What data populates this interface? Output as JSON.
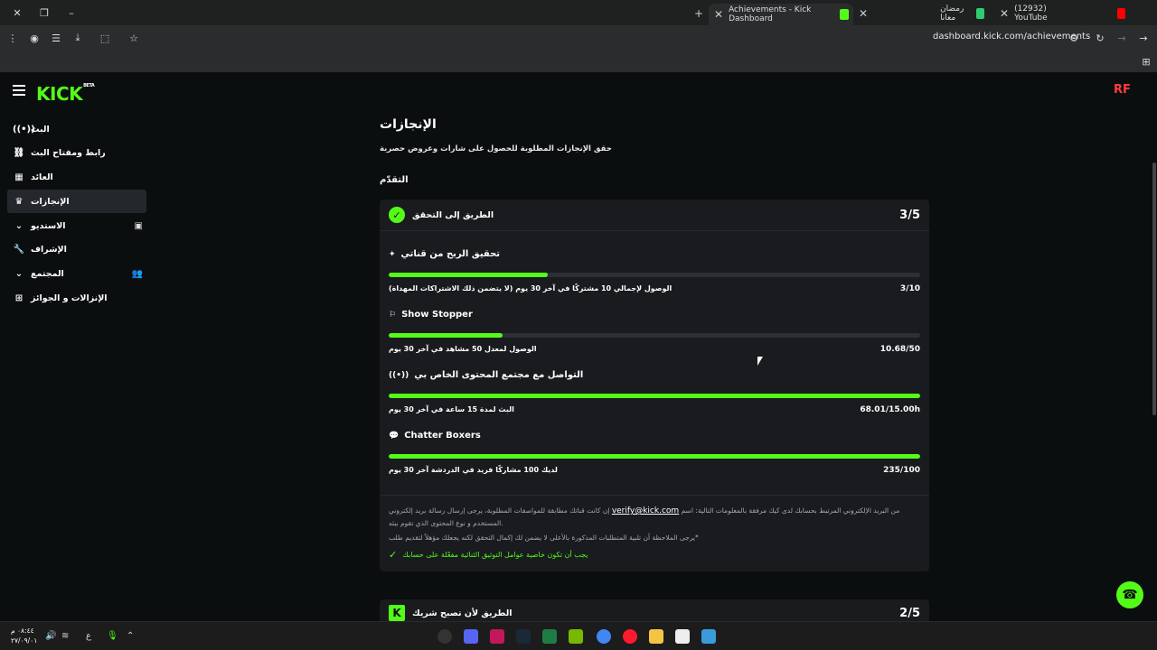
{
  "browser": {
    "tabs": [
      {
        "label": "(12932) YouTube",
        "color": "#ff0000"
      },
      {
        "label": "رمضان معانا",
        "color": "#2ecc71"
      },
      {
        "label": "Achievements - Kick Dashboard",
        "color": "#53fc18"
      }
    ],
    "url": "dashboard.kick.com/achievements"
  },
  "header": {
    "logo": "KICK",
    "logo_beta": "BETA",
    "avatar_text": "RF"
  },
  "sidebar": {
    "items": [
      {
        "label": "البث",
        "icon": "((•))"
      },
      {
        "label": "رابط ومفتاح البث",
        "icon": "🔗"
      },
      {
        "label": "العائد",
        "icon": "▦"
      },
      {
        "label": "الإنجازات",
        "icon": "🏆"
      },
      {
        "label": "الاستديو",
        "icon": "⌄"
      },
      {
        "label": "الإشراف",
        "icon": "🔧"
      },
      {
        "label": "المجتمع",
        "icon": "⌄"
      },
      {
        "label": "الإنزالات و الجوائز",
        "icon": "⊞"
      }
    ]
  },
  "main": {
    "title": "الإنجازات",
    "subtitle": "حقق الإنجازات المطلوبة للحصول على شارات وعروض حصرية",
    "section": "التقدّم",
    "card": {
      "title": "الطريق إلى التحقق",
      "count": "3/5",
      "achievements": [
        {
          "title": "تحقيق الربح من قناتي",
          "icon": "✦",
          "desc": "الوصول لإجمالي 10 مشتركًا في آخر 30 يوم (لا يتضمن ذلك الاشتراكات المهداة)",
          "value": "3/10",
          "progress": 0.3
        },
        {
          "title": "Show Stopper",
          "icon": "⚐",
          "desc": "الوصول لمعدل 50 مشاهد في آخر 30 يوم",
          "value": "10.68/50",
          "progress": 0.2136
        },
        {
          "title": "التواصل مع مجتمع المحتوى الخاص بي",
          "icon": "((•))",
          "desc": "البث لمدة 15 ساعة في آخر 30 يوم",
          "value": "68.01/15.00h",
          "progress": 1.0
        },
        {
          "title": "Chatter Boxers",
          "icon": "💬",
          "desc": "لديك 100 مشاركًا فريد في الدردشة آخر 30 يوم",
          "value": "235/100",
          "progress": 1.0
        }
      ],
      "footer_1": "إن كانت قناتك مطابقة للمواصفات المطلوبة، يرجى إرسال رسالة بريد إلكتروني",
      "footer_email": "verify@kick.com",
      "footer_2": "من البريد الإلكتروني المرتبط بحسابك لدى كيك مرفقة بالمعلومات التالية: اسم المستخدم و نوع المحتوى الذي تقوم ببثه.",
      "footer_3": "يرجى الملاحظة أن تلبية المتطلبات المذكورة بالأعلى لا يضمن لك إكمال التحقق لكنه يجعلك مؤهلاً لتقديم طلب*",
      "requirement": "يجب أن تكون خاصية عوامل التوثيق الثنائية مفعّلة على حسابك"
    },
    "card2": {
      "title": "الطريق لأن تصبح شريك",
      "count": "2/5",
      "badge": "K"
    }
  },
  "taskbar": {
    "time": "٠٨:٤٤ م",
    "date": "٢٧/٠٩/٠١",
    "lang": "ع"
  }
}
